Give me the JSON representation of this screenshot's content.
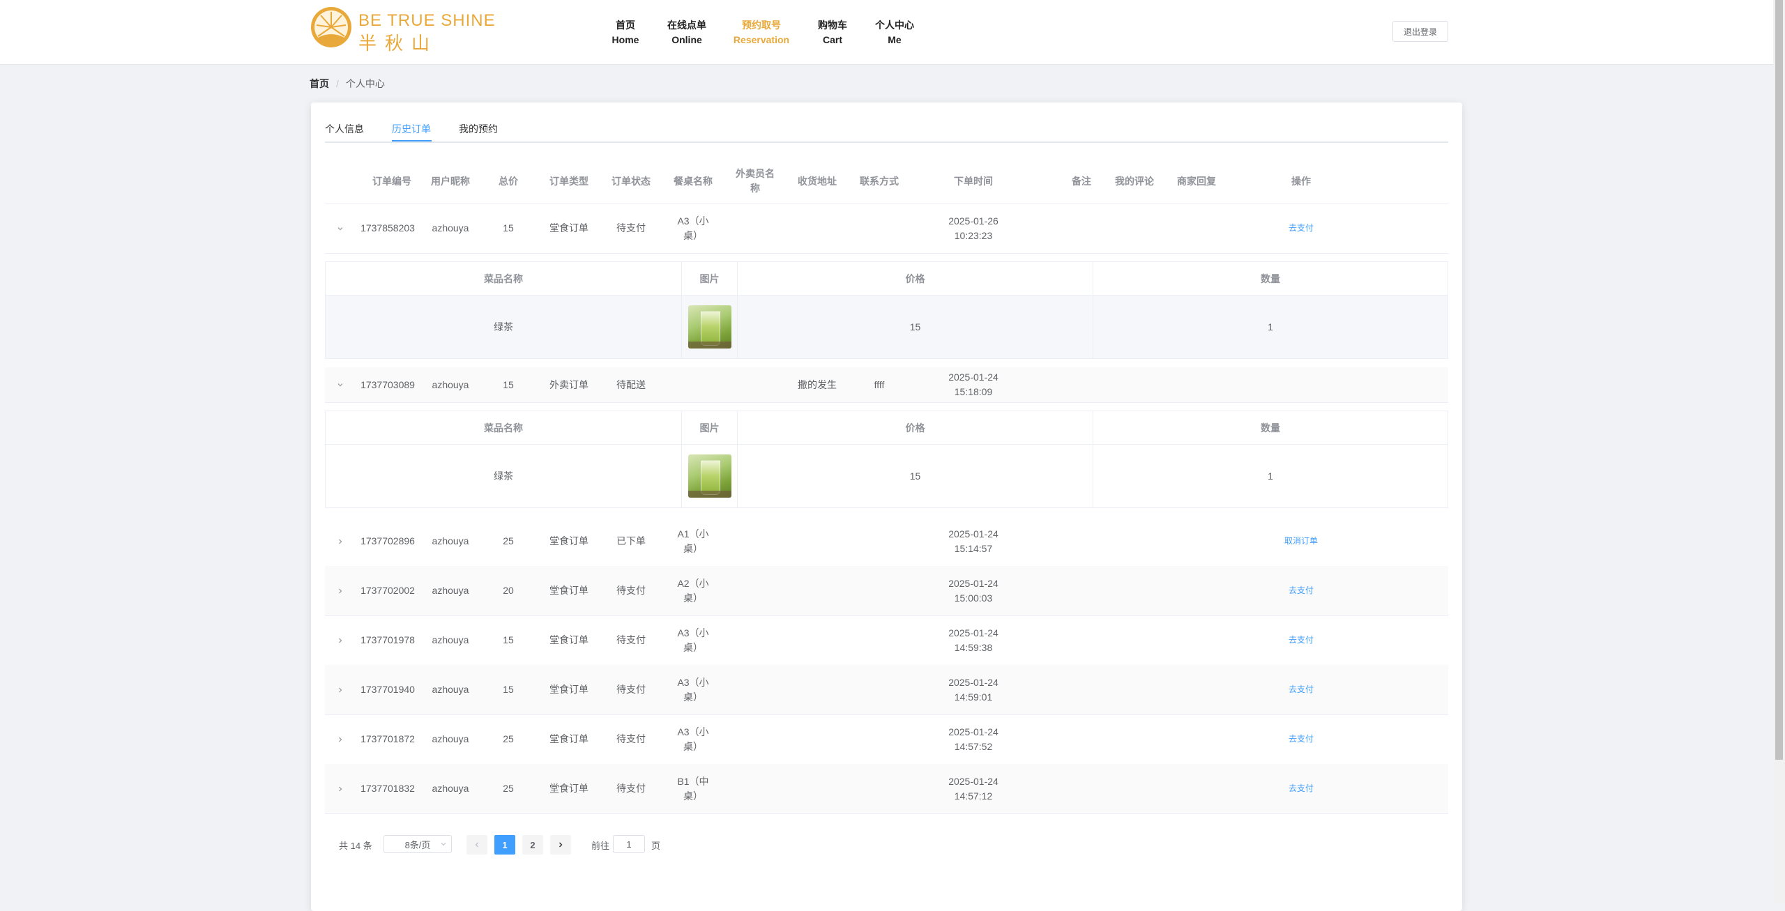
{
  "brand": {
    "name_en": "BE TRUE SHINE",
    "name_cn": "半秋山",
    "accent_color": "#e9a93a",
    "logo_icon": "sunburst-badge-icon"
  },
  "nav": {
    "items": [
      {
        "cn": "首页",
        "en": "Home"
      },
      {
        "cn": "在线点单",
        "en": "Online"
      },
      {
        "cn": "预约取号",
        "en": "Reservation"
      },
      {
        "cn": "购物车",
        "en": "Cart"
      },
      {
        "cn": "个人中心",
        "en": "Me"
      }
    ],
    "active_index": 2,
    "logout_label": "退出登录"
  },
  "breadcrumb": {
    "home": "首页",
    "separator": "/",
    "current": "个人中心"
  },
  "tabs": {
    "items": [
      "个人信息",
      "历史订单",
      "我的预约"
    ],
    "active_index": 1
  },
  "orders_table": {
    "columns": [
      "订单编号",
      "用户昵称",
      "总价",
      "订单类型",
      "订单状态",
      "餐桌名称",
      "外卖员名称",
      "收货地址",
      "联系方式",
      "下单时间",
      "备注",
      "我的评论",
      "商家回复",
      "操作"
    ],
    "rows": [
      {
        "id": "1737858203",
        "user": "azhouya",
        "total": "15",
        "type": "堂食订单",
        "status": "待支付",
        "table": "A3（小桌）",
        "courier": "",
        "address": "",
        "phone": "",
        "time": "2025-01-26 10:23:23",
        "remark": "",
        "comment": "",
        "reply": "",
        "action": "去支付",
        "expanded": true
      },
      {
        "id": "1737703089",
        "user": "azhouya",
        "total": "15",
        "type": "外卖订单",
        "status": "待配送",
        "table": "",
        "courier": "",
        "address": "撒的发生",
        "phone": "ffff",
        "time": "2025-01-24 15:18:09",
        "remark": "",
        "comment": "",
        "reply": "",
        "action": "",
        "expanded": true
      },
      {
        "id": "1737702896",
        "user": "azhouya",
        "total": "25",
        "type": "堂食订单",
        "status": "已下单",
        "table": "A1（小桌）",
        "courier": "",
        "address": "",
        "phone": "",
        "time": "2025-01-24 15:14:57",
        "remark": "",
        "comment": "",
        "reply": "",
        "action": "取消订单",
        "expanded": false
      },
      {
        "id": "1737702002",
        "user": "azhouya",
        "total": "20",
        "type": "堂食订单",
        "status": "待支付",
        "table": "A2（小桌）",
        "courier": "",
        "address": "",
        "phone": "",
        "time": "2025-01-24 15:00:03",
        "remark": "",
        "comment": "",
        "reply": "",
        "action": "去支付",
        "expanded": false
      },
      {
        "id": "1737701978",
        "user": "azhouya",
        "total": "15",
        "type": "堂食订单",
        "status": "待支付",
        "table": "A3（小桌）",
        "courier": "",
        "address": "",
        "phone": "",
        "time": "2025-01-24 14:59:38",
        "remark": "",
        "comment": "",
        "reply": "",
        "action": "去支付",
        "expanded": false
      },
      {
        "id": "1737701940",
        "user": "azhouya",
        "total": "15",
        "type": "堂食订单",
        "status": "待支付",
        "table": "A3（小桌）",
        "courier": "",
        "address": "",
        "phone": "",
        "time": "2025-01-24 14:59:01",
        "remark": "",
        "comment": "",
        "reply": "",
        "action": "去支付",
        "expanded": false
      },
      {
        "id": "1737701872",
        "user": "azhouya",
        "total": "25",
        "type": "堂食订单",
        "status": "待支付",
        "table": "A3（小桌）",
        "courier": "",
        "address": "",
        "phone": "",
        "time": "2025-01-24 14:57:52",
        "remark": "",
        "comment": "",
        "reply": "",
        "action": "去支付",
        "expanded": false
      },
      {
        "id": "1737701832",
        "user": "azhouya",
        "total": "25",
        "type": "堂食订单",
        "status": "待支付",
        "table": "B1（中桌）",
        "courier": "",
        "address": "",
        "phone": "",
        "time": "2025-01-24 14:57:12",
        "remark": "",
        "comment": "",
        "reply": "",
        "action": "去支付",
        "expanded": false
      }
    ]
  },
  "order_items_table": {
    "columns": [
      "菜品名称",
      "图片",
      "价格",
      "数量"
    ],
    "details": [
      {
        "dish": "绿茶",
        "image": "green-tea-photo",
        "price": "15",
        "qty": "1"
      },
      {
        "dish": "绿茶",
        "image": "green-tea-photo",
        "price": "15",
        "qty": "1"
      }
    ]
  },
  "pagination": {
    "total_label": "共 14 条",
    "page_size_label": "8条/页",
    "pages": [
      "1",
      "2"
    ],
    "current_page": "1",
    "goto_prefix": "前往",
    "goto_value": "1",
    "goto_suffix": "页",
    "active_color": "#409eff"
  }
}
